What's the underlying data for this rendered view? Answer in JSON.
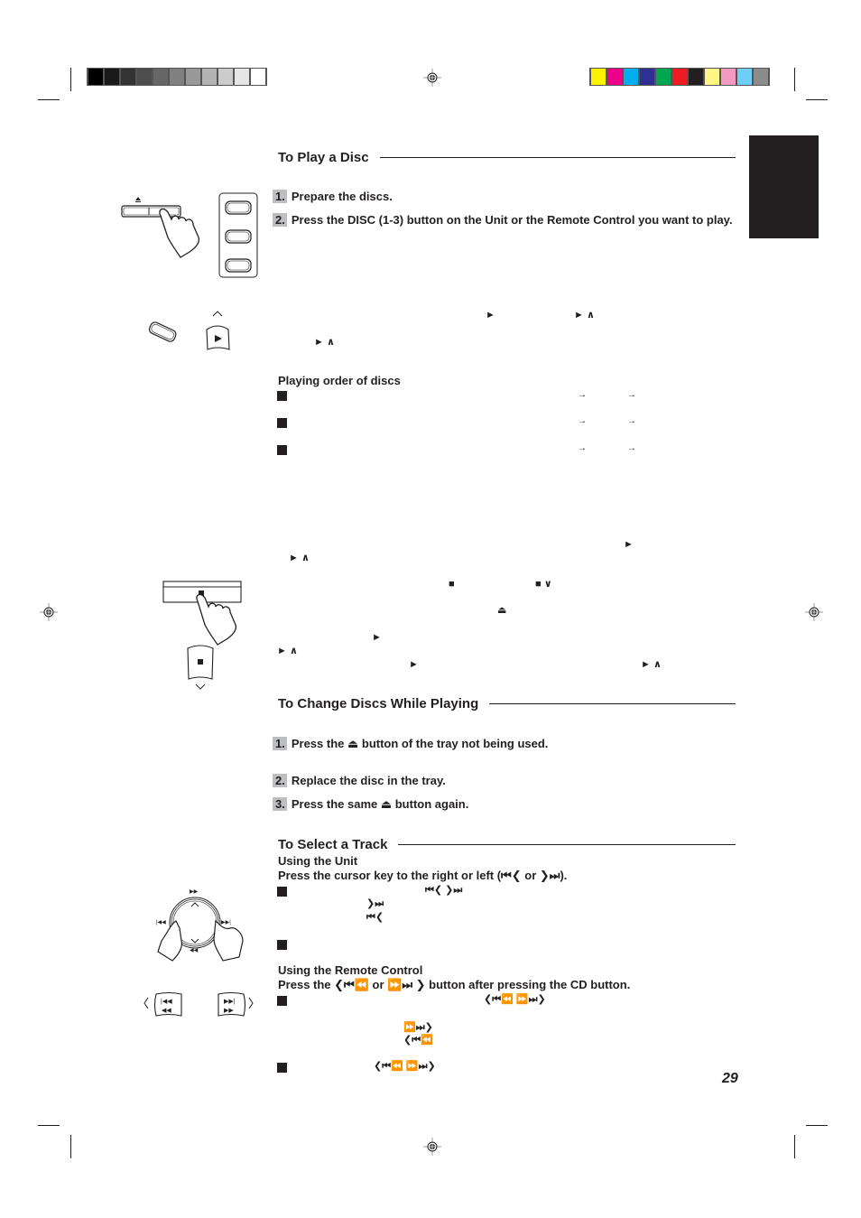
{
  "color_bars": {
    "grayscale": [
      "#000000",
      "#1a1a1a",
      "#333333",
      "#4d4d4d",
      "#666666",
      "#808080",
      "#999999",
      "#b3b3b3",
      "#cccccc",
      "#e6e6e6",
      "#ffffff"
    ],
    "color": [
      "#fff200",
      "#ec008c",
      "#00aeef",
      "#2e3192",
      "#00a651",
      "#ed1c24",
      "#231f20",
      "#fff685",
      "#f49ac1",
      "#6dcff6",
      "#8c8c8c"
    ]
  },
  "sections": {
    "play_disc": {
      "title": "To Play a Disc",
      "steps": [
        {
          "num": "1.",
          "text": "Prepare the discs."
        },
        {
          "num": "2.",
          "text": "Press the DISC (1-3) button on the Unit or the Remote Control you want to play."
        }
      ],
      "playing_order_heading": "Playing order of discs"
    },
    "change_discs": {
      "title": "To Change Discs While Playing",
      "steps": [
        {
          "num": "1.",
          "text": "Press the ⏏ button of the tray not being used."
        },
        {
          "num": "2.",
          "text": "Replace the disc in the tray."
        },
        {
          "num": "3.",
          "text": "Press the same ⏏ button again."
        }
      ]
    },
    "select_track": {
      "title": "To Select a Track",
      "using_unit": "Using the Unit",
      "unit_instruction": "Press the cursor key to the right or left (⏮❮ or ❯⏭).",
      "using_remote": "Using the Remote Control",
      "remote_instruction": "Press the ❮⏮⏪  or ⏩⏭ ❯ button after pressing the CD button."
    }
  },
  "symbols": {
    "play": "►",
    "play_up": "► ∧",
    "stop": "■",
    "stop_down": "■ ∨",
    "eject": "⏏",
    "arrow_right": "→",
    "prev_left": "⏮❮",
    "next_right": "❯⏭",
    "prev_unit_pair": "⏮❮   ❯⏭",
    "remote_pair": "❮⏮⏪    ⏩⏭❯",
    "remote_next": "⏩⏭❯",
    "remote_prev": "❮⏮⏪"
  },
  "illustrations": {
    "eject_symbol": "⏏",
    "play_symbol": "►",
    "stop_symbol": "■",
    "up_caret": "∧",
    "down_caret": "∨",
    "dial_top": "⏩",
    "dial_bottom": "⏪",
    "dial_left": "⏮",
    "dial_right": "⏭",
    "remote_prev_top": "⏮",
    "remote_prev_bottom": "⏪",
    "remote_next_top": "⏭",
    "remote_next_bottom": "⏩",
    "left_caret": "❮",
    "right_caret": "❯"
  },
  "page_number": "29"
}
